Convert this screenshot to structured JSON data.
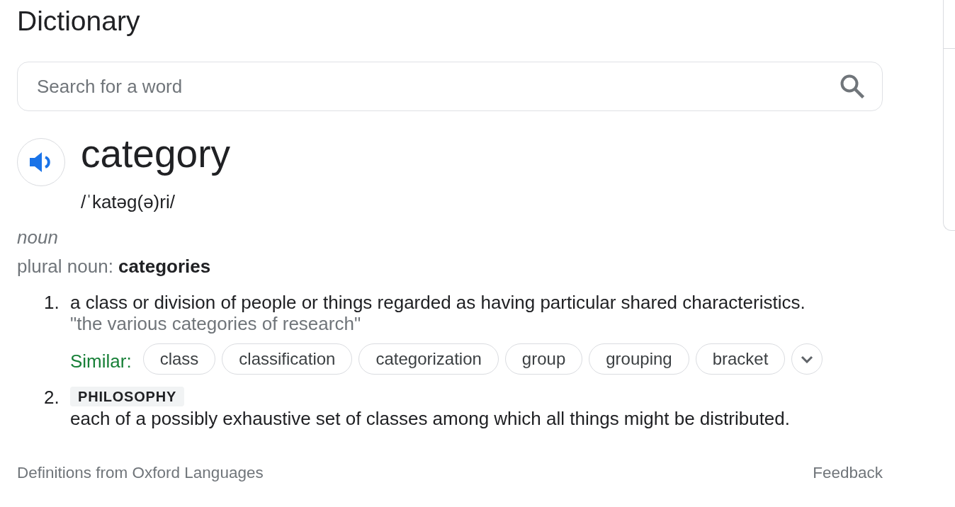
{
  "title": "Dictionary",
  "search": {
    "placeholder": "Search for a word"
  },
  "entry": {
    "word": "category",
    "pronunciation": "/ˈkatəg(ə)ri/",
    "part_of_speech": "noun",
    "inflection": "plural noun: **categories**",
    "senses": [
      {
        "number": "1.",
        "definition": "a class or division of people or things regarded as having particular shared characteristics.",
        "example": "\"the various categories of research\"",
        "similar": {
          "label": "Similar:",
          "words": [
            "class",
            "classification",
            "categorization",
            "group",
            "grouping",
            "bracket"
          ],
          "expanded": false
        }
      },
      {
        "number": "2.",
        "domain": "PHILOSOPHY",
        "definition": "each of a possibly exhaustive set of classes among which all things might be distributed."
      }
    ]
  },
  "footer": {
    "source": "Definitions from Oxford Languages",
    "feedback": "Feedback"
  }
}
